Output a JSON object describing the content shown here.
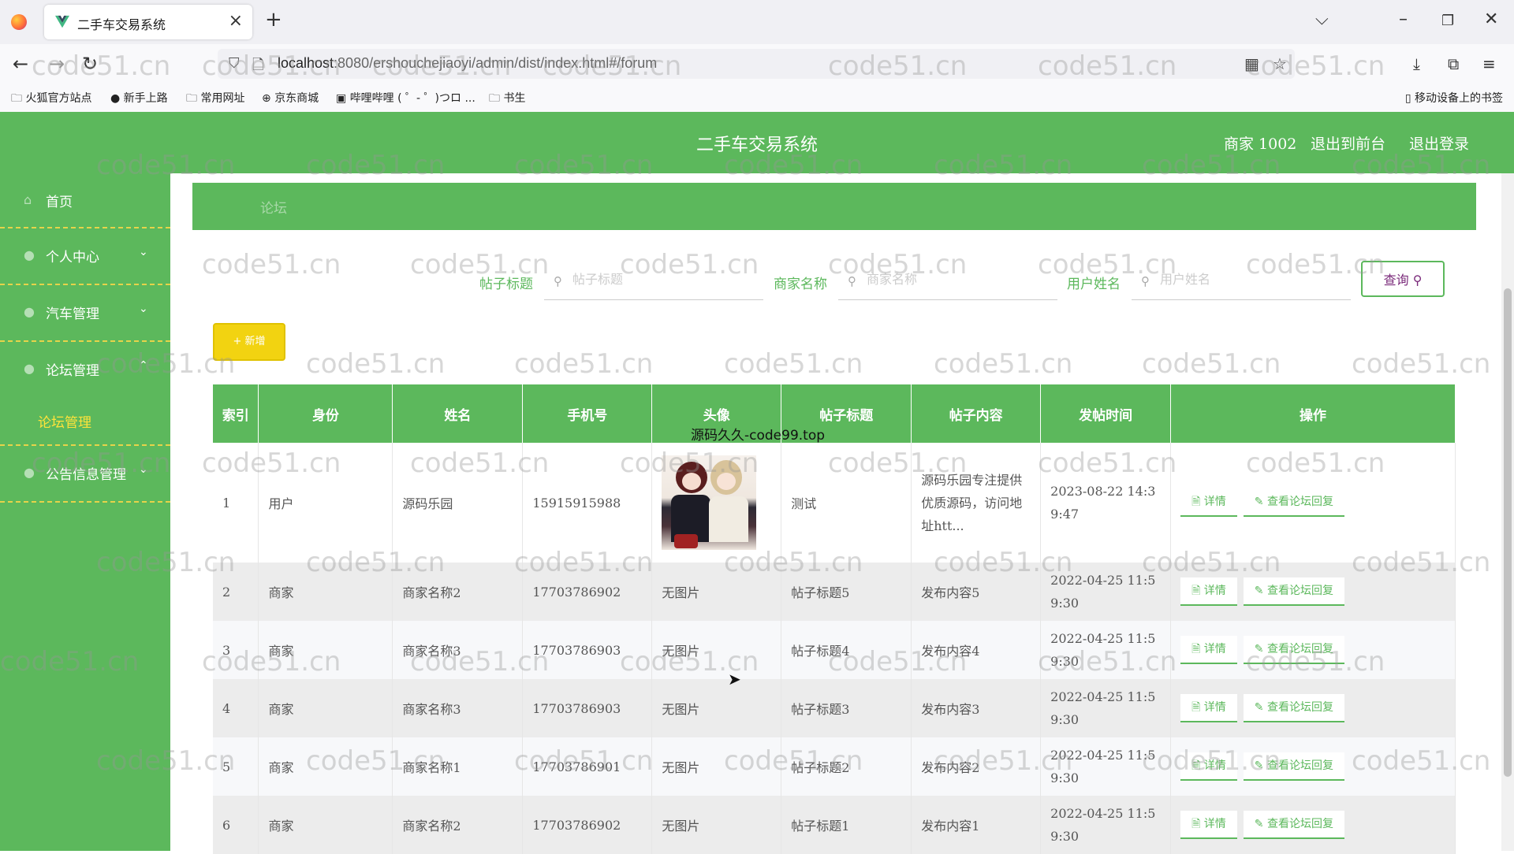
{
  "browser": {
    "tab_title": "二手车交易系统",
    "url_host": "localhost",
    "url_rest": ":8080/ershouchejiaoyi/admin/dist/index.html#/forum",
    "bookmarks": [
      "火狐官方站点",
      "新手上路",
      "常用网址",
      "京东商城",
      "哔哩哔哩 ( ゜- ゜)つロ ...",
      "书生"
    ],
    "bookmarks_right": "移动设备上的书签"
  },
  "header": {
    "title": "二手车交易系统",
    "user": "商家 1002",
    "to_front": "退出到前台",
    "logout": "退出登录"
  },
  "sidebar": {
    "items": [
      {
        "label": "首页"
      },
      {
        "label": "个人中心"
      },
      {
        "label": "汽车管理"
      },
      {
        "label": "论坛管理"
      },
      {
        "label": "公告信息管理"
      }
    ],
    "sub_item": "论坛管理"
  },
  "breadcrumb": "论坛",
  "search": {
    "title_label": "帖子标题",
    "title_placeholder": "帖子标题",
    "merchant_label": "商家名称",
    "merchant_placeholder": "商家名称",
    "user_label": "用户姓名",
    "user_placeholder": "用户姓名",
    "query_button": "查询"
  },
  "add_button": "+ 新增",
  "table": {
    "headers": [
      "索引",
      "身份",
      "姓名",
      "手机号",
      "头像",
      "帖子标题",
      "帖子内容",
      "发帖时间",
      "操作"
    ],
    "rows": [
      {
        "idx": "1",
        "role": "用户",
        "name": "源码乐园",
        "phone": "15915915988",
        "avatar": "",
        "title": "测试",
        "content": "源码乐园专注提供优质源码，访问地址htt...",
        "time": "2023-08-22 14:39:47"
      },
      {
        "idx": "2",
        "role": "商家",
        "name": "商家名称2",
        "phone": "17703786902",
        "avatar": "无图片",
        "title": "帖子标题5",
        "content": "发布内容5",
        "time": "2022-04-25 11:59:30"
      },
      {
        "idx": "3",
        "role": "商家",
        "name": "商家名称3",
        "phone": "17703786903",
        "avatar": "无图片",
        "title": "帖子标题4",
        "content": "发布内容4",
        "time": "2022-04-25 11:59:30"
      },
      {
        "idx": "4",
        "role": "商家",
        "name": "商家名称3",
        "phone": "17703786903",
        "avatar": "无图片",
        "title": "帖子标题3",
        "content": "发布内容3",
        "time": "2022-04-25 11:59:30"
      },
      {
        "idx": "5",
        "role": "商家",
        "name": "商家名称1",
        "phone": "17703786901",
        "avatar": "无图片",
        "title": "帖子标题2",
        "content": "发布内容2",
        "time": "2022-04-25 11:59:30"
      },
      {
        "idx": "6",
        "role": "商家",
        "name": "商家名称2",
        "phone": "17703786902",
        "avatar": "无图片",
        "title": "帖子标题1",
        "content": "发布内容1",
        "time": "2022-04-25 11:59:30"
      }
    ],
    "action_detail": "详情",
    "action_reply": "查看论坛回复"
  },
  "overlay_text": "源码久久-code99.top",
  "watermark": "code51.cn",
  "colors": {
    "primary": "#5cb85c",
    "accent": "#f2d311",
    "sub_active": "#ffe33a"
  }
}
